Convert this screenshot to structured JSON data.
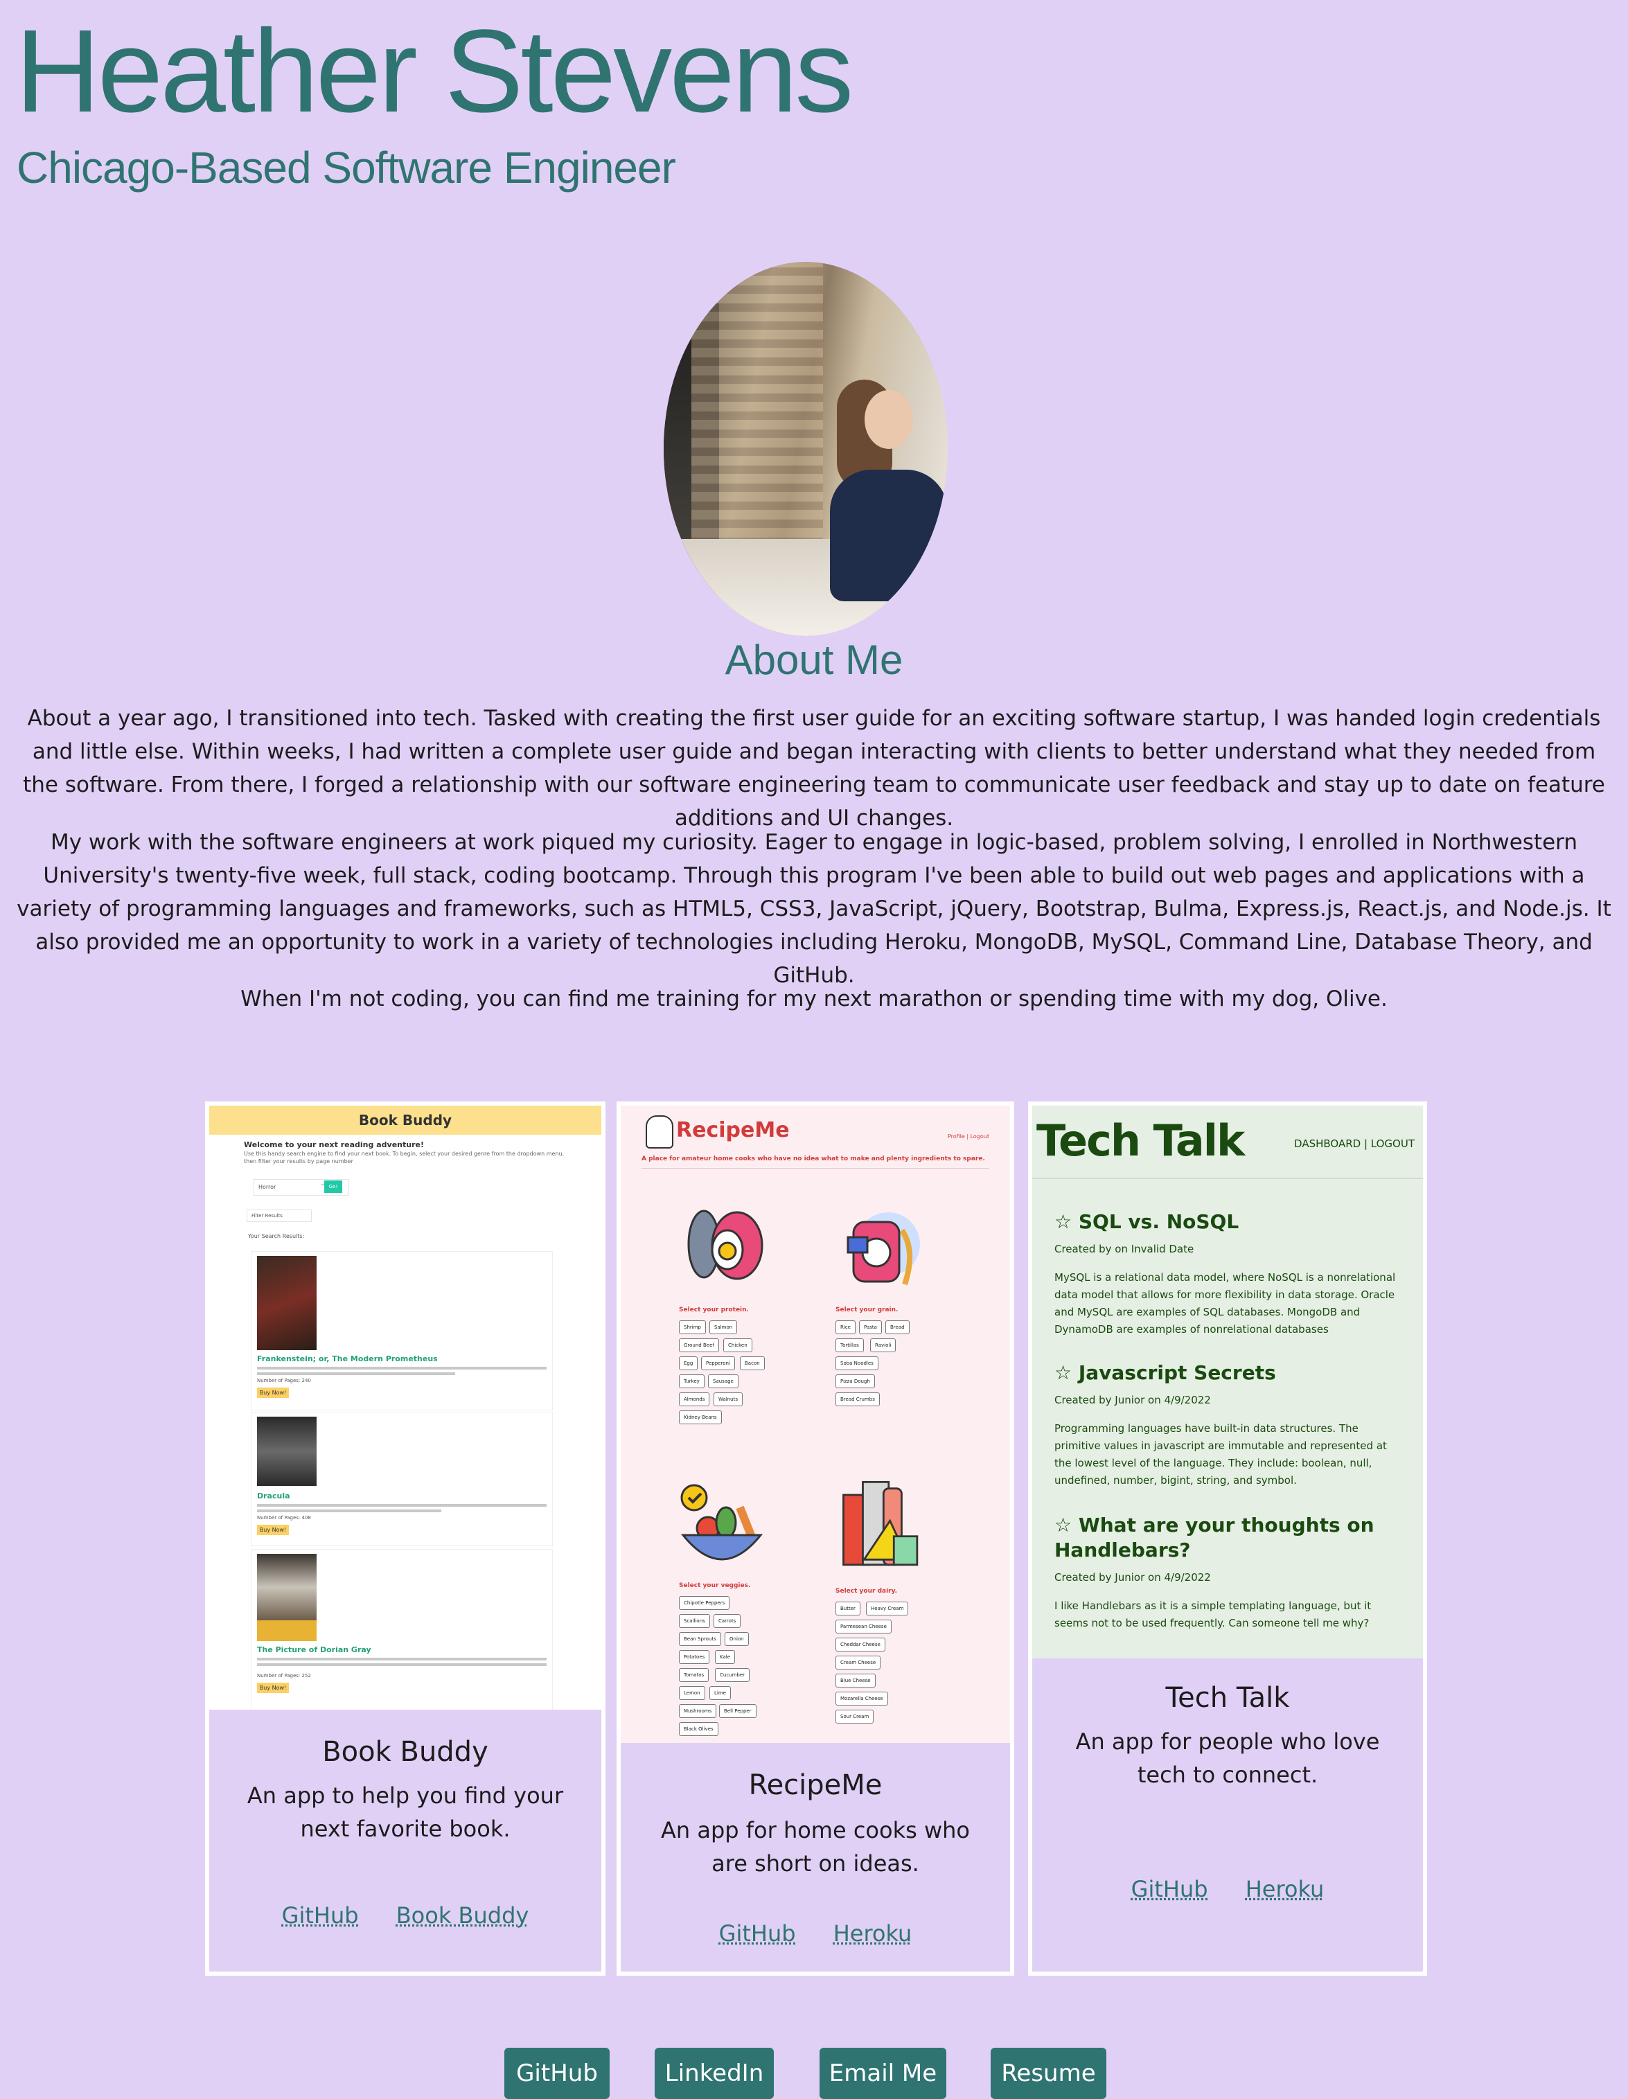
{
  "header": {
    "name": "Heather Stevens",
    "subtitle": "Chicago-Based Software Engineer"
  },
  "about": {
    "title": "About Me",
    "paragraphs": [
      "About a year ago, I transitioned into tech. Tasked with creating the first user guide for an exciting software startup, I was handed login credentials and little else. Within weeks, I had written a complete user guide and began interacting with clients to better understand what they needed from the software. From there, I forged a relationship with our software engineering team to communicate user feedback and stay up to date on feature additions and UI changes.",
      "My work with the software engineers at work piqued my curiosity. Eager to engage in logic-based, problem solving, I enrolled in Northwestern University's twenty-five week, full stack, coding bootcamp. Through this program I've been able to build out web pages and applications with a variety of programming languages and frameworks, such as HTML5, CSS3, JavaScript, jQuery, Bootstrap, Bulma, Express.js, React.js, and Node.js. It also provided me an opportunity to work in a variety of technologies including Heroku, MongoDB, MySQL, Command Line, Database Theory, and GitHub.",
      "When I'm not coding, you can find me training for my next marathon or spending time with my dog, Olive."
    ]
  },
  "projects": [
    {
      "title": "Book Buddy",
      "description": "An app to help you find your next favorite book.",
      "links": [
        "GitHub",
        "Book Buddy"
      ],
      "screenshot": {
        "header": "Book Buddy",
        "welcome": "Welcome to your next reading adventure!",
        "intro": "Use this handy search engine to find your next book. To begin, select your desired genre from the dropdown menu, then filter your results by page number",
        "genre_select": "Horror",
        "go_button": "Go!",
        "filter_select": "Filter Results",
        "results_label": "Your Search Results:",
        "books": [
          {
            "title": "Frankenstein; or, The Modern Prometheus",
            "pages": "Number of Pages: 240"
          },
          {
            "title": "Dracula",
            "pages": "Number of Pages: 408"
          },
          {
            "title": "The Picture of Dorian Gray",
            "pages": "Number of Pages: 252"
          }
        ],
        "buy_label": "Buy Now!"
      }
    },
    {
      "title": "RecipeMe",
      "description": "An app for home cooks who are short on ideas.",
      "links": [
        "GitHub",
        "Heroku"
      ],
      "screenshot": {
        "logo": "RecipeMe",
        "nav": "Profile | Logout",
        "tagline": "A place for amateur home cooks who have no idea what to make and plenty ingredients to spare.",
        "protein_label": "Select your protein.",
        "protein": [
          "Shrimp",
          "Salmon",
          "Ground Beef",
          "Chicken",
          "Egg",
          "Pepperoni",
          "Bacon",
          "Turkey",
          "Sausage",
          "Almonds",
          "Walnuts",
          "Kidney Beans"
        ],
        "grain_label": "Select your grain.",
        "grain": [
          "Rice",
          "Pasta",
          "Bread",
          "Tortillas",
          "Ravioli",
          "Soba Noodles",
          "Pizza Dough",
          "Bread Crumbs"
        ],
        "veggie_label": "Select your veggies.",
        "veggies": [
          "Chipotle Peppers",
          "Scallions",
          "Carrots",
          "Bean Sprouts",
          "Onion",
          "Potatoes",
          "Kale",
          "Tomatos",
          "Cucumber",
          "Lemon",
          "Lime",
          "Mushrooms",
          "Bell Pepper",
          "Black Olives"
        ],
        "dairy_label": "Select your dairy.",
        "dairy": [
          "Butter",
          "Heavy Cream",
          "Parmesean Cheese",
          "Cheddar Cheese",
          "Cream Cheese",
          "Blue Cheese",
          "Mozarella Cheese",
          "Sour Cream"
        ]
      }
    },
    {
      "title": "Tech Talk",
      "description": "An app for people who love tech to connect.",
      "links": [
        "GitHub",
        "Heroku"
      ],
      "screenshot": {
        "logo": "Tech Talk",
        "nav": "DASHBOARD | LOGOUT",
        "posts": [
          {
            "title": "☆ SQL vs. NoSQL",
            "meta": "Created by on Invalid Date",
            "body": "MySQL is a relational data model, where NoSQL is a nonrelational data model that allows for more flexibility in data storage. Oracle and MySQL are examples of SQL databases. MongoDB and DynamoDB are examples of nonrelational databases"
          },
          {
            "title": "☆ Javascript Secrets",
            "meta": "Created by Junior on 4/9/2022",
            "body": "Programming languages have built-in data structures. The primitive values in javascript are immutable and represented at the lowest level of the language. They include: boolean, null, undefined, number, bigint, string, and symbol."
          },
          {
            "title": "☆ What are your thoughts on Handlebars?",
            "meta": "Created by Junior on 4/9/2022",
            "body": "I like Handlebars as it is a simple templating language, but it seems not to be used frequently. Can someone tell me why?"
          }
        ]
      }
    }
  ],
  "footer_buttons": [
    "GitHub",
    "LinkedIn",
    "Email Me",
    "Resume"
  ],
  "colors": {
    "background": "#e1d0f6",
    "accent": "#2f7471",
    "card_border": "#ffffff"
  }
}
